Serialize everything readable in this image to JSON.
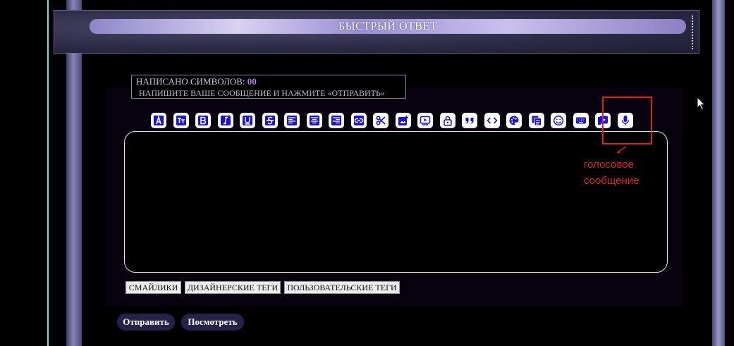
{
  "header": {
    "title": "БЫСТРЫЙ ОТВЕТ"
  },
  "info": {
    "count_label": "НАПИСАНО СИМВОЛОВ:",
    "count_value": "00",
    "hint": "НАПИШИТЕ ВАШЕ СООБЩЕНИЕ И НАЖМИТЕ «ОТПРАВИТЬ»"
  },
  "toolbar": {
    "icons": [
      "font-color-icon",
      "font-size-icon",
      "bold-icon",
      "italic-icon",
      "underline-icon",
      "strikethrough-icon",
      "align-left-icon",
      "align-center-icon",
      "align-right-icon",
      "link-icon",
      "scissors-icon",
      "add-image-icon",
      "video-icon",
      "lock-icon",
      "quote-icon",
      "code-icon",
      "palette-icon",
      "copy-icon",
      "smiley-icon",
      "keyboard-icon",
      "video-note-icon",
      "microphone-icon"
    ],
    "icon_color": "#1a12d6"
  },
  "editor": {
    "value": ""
  },
  "tags": {
    "smilies": "СМАЙЛИКИ",
    "designer": "ДИЗАЙНЕРСКИЕ ТЕГИ",
    "user": "ПОЛЬЗОВАТЕЛЬСКИЕ ТЕГИ"
  },
  "actions": {
    "submit": "Отправить",
    "preview": "Посмотреть"
  },
  "annotation": {
    "line1": "голосовое",
    "line2": "сообщение",
    "color": "#e01f24"
  }
}
